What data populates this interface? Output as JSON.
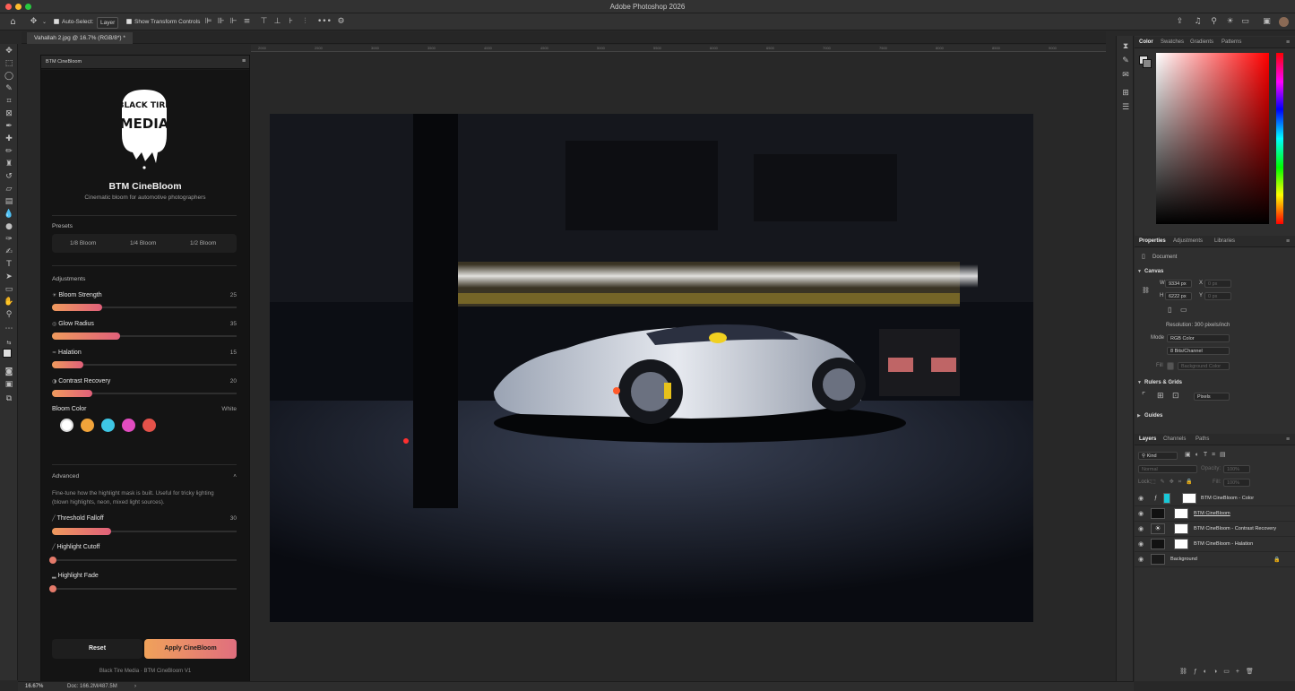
{
  "app": {
    "title": "Adobe Photoshop 2026"
  },
  "options_bar": {
    "auto_select_label": "Auto-Select:",
    "auto_select_value": "Layer",
    "transform_label": "Show Transform Controls",
    "more": "•••"
  },
  "document": {
    "tab_label": "Vahallah 2.jpg @ 16.7% (RGB/8*) *",
    "zoom": "16.67%",
    "doc_size": "Doc: 166.2M/487.5M"
  },
  "ruler": [
    "2000",
    "2500",
    "3000",
    "3500",
    "4000",
    "4500",
    "5000",
    "5500",
    "6000",
    "6500",
    "7000",
    "7500",
    "8000",
    "8500",
    "9000"
  ],
  "plugin": {
    "panel_tab": "BTM CineBloom",
    "logo_text": "BLACK TIRE MEDIA",
    "title": "BTM CineBloom",
    "subtitle": "Cinematic bloom for automotive photographers",
    "presets_label": "Presets",
    "presets": [
      "1/8 Bloom",
      "1/4 Bloom",
      "1/2 Bloom"
    ],
    "adjustments_label": "Adjustments",
    "sliders": [
      {
        "icon": "☀",
        "label": "Bloom Strength",
        "value": "25",
        "fraction": 0.27
      },
      {
        "icon": "◎",
        "label": "Glow Radius",
        "value": "35",
        "fraction": 0.37
      },
      {
        "icon": "≈",
        "label": "Halation",
        "value": "15",
        "fraction": 0.17
      },
      {
        "icon": "◑",
        "label": "Contrast Recovery",
        "value": "20",
        "fraction": 0.22
      }
    ],
    "bloom_color_label": "Bloom Color",
    "bloom_color_value": "White",
    "bloom_colors": [
      "#ffffff",
      "#f2a43a",
      "#3ec6e4",
      "#e24cc0",
      "#e4524a"
    ],
    "advanced_label": "Advanced",
    "advanced_toggle": "˄",
    "advanced_desc": "Fine-tune how the highlight mask is built. Useful for tricky lighting (blown highlights, neon, mixed light sources).",
    "advanced_sliders": [
      {
        "icon": "╱",
        "label": "Threshold Falloff",
        "value": "30",
        "fraction": 0.32
      },
      {
        "icon": "╱",
        "label": "Highlight Cutoff",
        "value": "",
        "fraction": 0.0
      },
      {
        "icon": "▂",
        "label": "Highlight Fade",
        "value": "",
        "fraction": 0.0
      }
    ],
    "reset_label": "Reset",
    "apply_label": "Apply CineBloom",
    "footer": "Black Tire Media · BTM CineBloom V1"
  },
  "color_panel": {
    "tabs": [
      "Color",
      "Swatches",
      "Gradients",
      "Patterns"
    ]
  },
  "properties_panel": {
    "tabs": [
      "Properties",
      "Adjustments",
      "Libraries"
    ],
    "document_label": "Document",
    "canvas_label": "Canvas",
    "w_label": "W",
    "w_value": "9334 px",
    "h_label": "H",
    "h_value": "6222 px",
    "x_label": "X",
    "x_value": "0 px",
    "y_label": "Y",
    "y_value": "0 px",
    "resolution": "Resolution: 300 pixels/inch",
    "mode_label": "Mode",
    "mode_value": "RGB Color",
    "bits_value": "8 Bits/Channel",
    "fill_label": "Fill",
    "fill_value": "Background Color",
    "rulers_label": "Rulers & Grids",
    "units_value": "Pixels",
    "guides_label": "Guides"
  },
  "layers_panel": {
    "tabs": [
      "Layers",
      "Channels",
      "Paths"
    ],
    "kind_label": "Kind",
    "blend_mode": "Normal",
    "opacity_label": "Opacity:",
    "opacity_value": "100%",
    "lock_label": "Lock:",
    "fill_label": "Fill:",
    "fill_value": "100%",
    "layers": [
      {
        "name": "BTM CineBloom - Color",
        "thumb": "#18c8d8"
      },
      {
        "name": "BTM CineBloom",
        "thumb": "#111111"
      },
      {
        "name": "BTM CineBloom - Contrast Recovery",
        "thumb": "#2a2a2a"
      },
      {
        "name": "BTM CineBloom - Halation",
        "thumb": "#111111"
      },
      {
        "name": "Background",
        "thumb": "#1a1a1a"
      }
    ]
  }
}
